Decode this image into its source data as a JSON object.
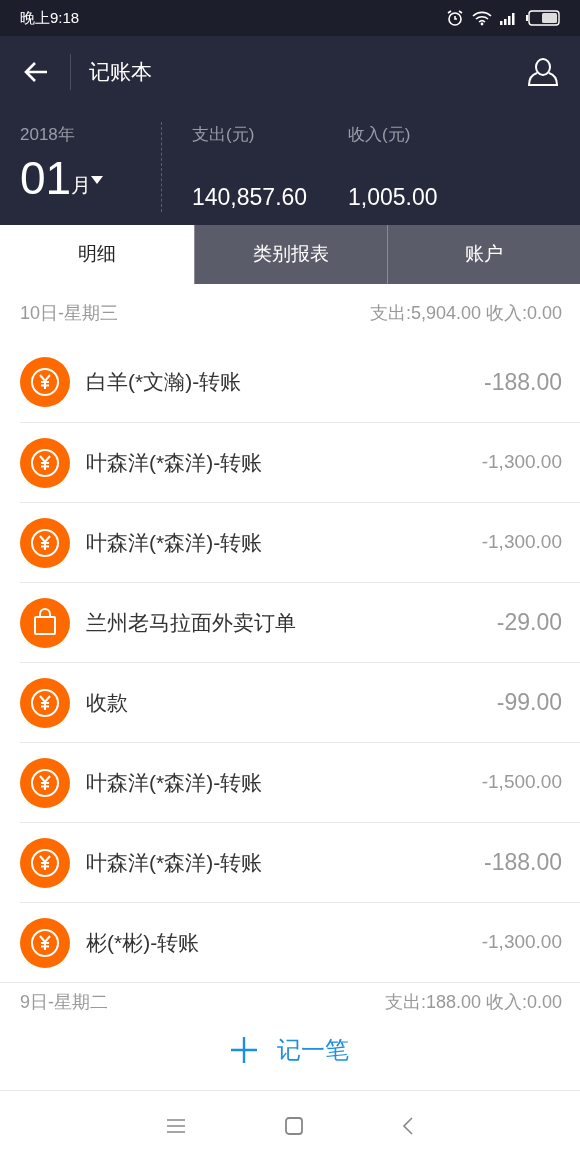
{
  "status_bar": {
    "time": "晚上9:18"
  },
  "header": {
    "title": "记账本"
  },
  "summary": {
    "year": "2018年",
    "month": "01",
    "month_unit": "月",
    "expense_label": "支出(元)",
    "expense": "140,857.60",
    "income_label": "收入(元)",
    "income": "1,005.00"
  },
  "tabs": [
    {
      "label": "明细",
      "selected": true
    },
    {
      "label": "类别报表",
      "selected": false
    },
    {
      "label": "账户",
      "selected": false
    }
  ],
  "days": [
    {
      "date": "10日-星期三",
      "totals": "支出:5,904.00 收入:0.00",
      "entries": [
        {
          "kind": "transfer",
          "title": "白羊(*文瀚)-转账",
          "amount": "-188.00"
        },
        {
          "kind": "transfer",
          "title": "叶森洋(*森洋)-转账",
          "amount": "-1,300.00"
        },
        {
          "kind": "transfer",
          "title": "叶森洋(*森洋)-转账",
          "amount": "-1,300.00"
        },
        {
          "kind": "shopping",
          "title": "兰州老马拉面外卖订单",
          "amount": "-29.00"
        },
        {
          "kind": "transfer",
          "title": "收款",
          "amount": "-99.00"
        },
        {
          "kind": "transfer",
          "title": "叶森洋(*森洋)-转账",
          "amount": "-1,500.00"
        },
        {
          "kind": "transfer",
          "title": "叶森洋(*森洋)-转账",
          "amount": "-188.00"
        },
        {
          "kind": "transfer",
          "title": "彬(*彬)-转账",
          "amount": "-1,300.00"
        }
      ]
    },
    {
      "date": "9日-星期二",
      "totals": "支出:188.00 收入:0.00"
    }
  ],
  "add_button": {
    "label": "记一笔"
  }
}
